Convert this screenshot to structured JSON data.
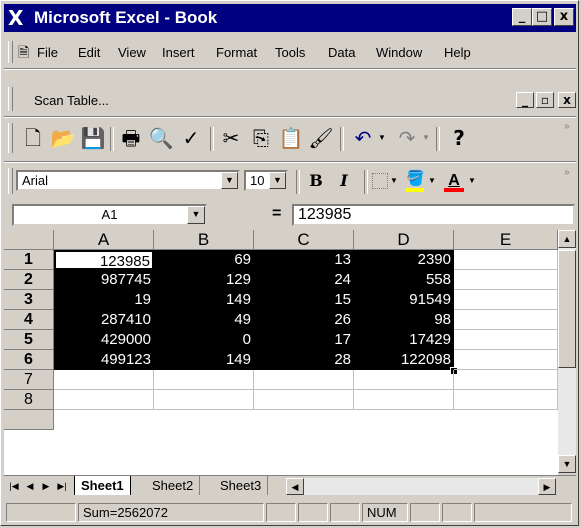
{
  "window": {
    "app_icon": "excel-x-icon",
    "app_icon_glyph": "X",
    "title": "Microsoft Excel - Book",
    "minimize_glyph": "_",
    "maximize_glyph": "□",
    "close_glyph": "x"
  },
  "menubar": {
    "items": [
      "File",
      "Edit",
      "View",
      "Insert",
      "Format",
      "Tools",
      "Data",
      "Window",
      "Help"
    ]
  },
  "scanbar": {
    "label": "Scan Table...",
    "min_glyph": "_",
    "restore_glyph": "▫",
    "close_glyph": "x"
  },
  "toolbar": {
    "buttons": [
      {
        "name": "new-icon",
        "glyph": "🗋"
      },
      {
        "name": "open-icon",
        "glyph": "📂"
      },
      {
        "name": "save-icon",
        "glyph": "💾"
      },
      {
        "name": "print-icon",
        "glyph": "🖶"
      },
      {
        "name": "print-preview-icon",
        "glyph": "🔍"
      },
      {
        "name": "spelling-icon",
        "glyph": "✓"
      },
      {
        "name": "cut-icon",
        "glyph": "✂"
      },
      {
        "name": "copy-icon",
        "glyph": "⎘"
      },
      {
        "name": "paste-icon",
        "glyph": "📋"
      },
      {
        "name": "format-painter-icon",
        "glyph": "🖌"
      },
      {
        "name": "undo-icon",
        "glyph": "↶"
      },
      {
        "name": "redo-icon",
        "glyph": "↷"
      },
      {
        "name": "help-icon",
        "glyph": "?"
      }
    ]
  },
  "format_bar": {
    "font": "Arial",
    "size": "10",
    "bold": "B",
    "italic": "I",
    "font_color": "A",
    "font_color_hex": "#ff0000",
    "fill_color_hex": "#ffff00"
  },
  "formula_bar": {
    "name_box": "A1",
    "equals": "=",
    "value": "123985"
  },
  "sheet": {
    "columns": [
      "A",
      "B",
      "C",
      "D",
      "E"
    ],
    "rows": [
      "1",
      "2",
      "3",
      "4",
      "5",
      "6",
      "7",
      "8"
    ],
    "cells": [
      [
        "123985",
        "69",
        "13",
        "2390"
      ],
      [
        "987745",
        "129",
        "24",
        "558"
      ],
      [
        "19",
        "149",
        "15",
        "91549"
      ],
      [
        "287410",
        "49",
        "26",
        "98"
      ],
      [
        "429000",
        "0",
        "17",
        "17429"
      ],
      [
        "499123",
        "149",
        "28",
        "122098"
      ]
    ],
    "selection_color": "#000000"
  },
  "tabs": {
    "nav": [
      "|◀",
      "◀",
      "▶",
      "▶|"
    ],
    "sheets": [
      "Sheet1",
      "Sheet2",
      "Sheet3"
    ],
    "active": "Sheet1"
  },
  "statusbar": {
    "sum": "Sum=2562072",
    "num": "NUM"
  }
}
